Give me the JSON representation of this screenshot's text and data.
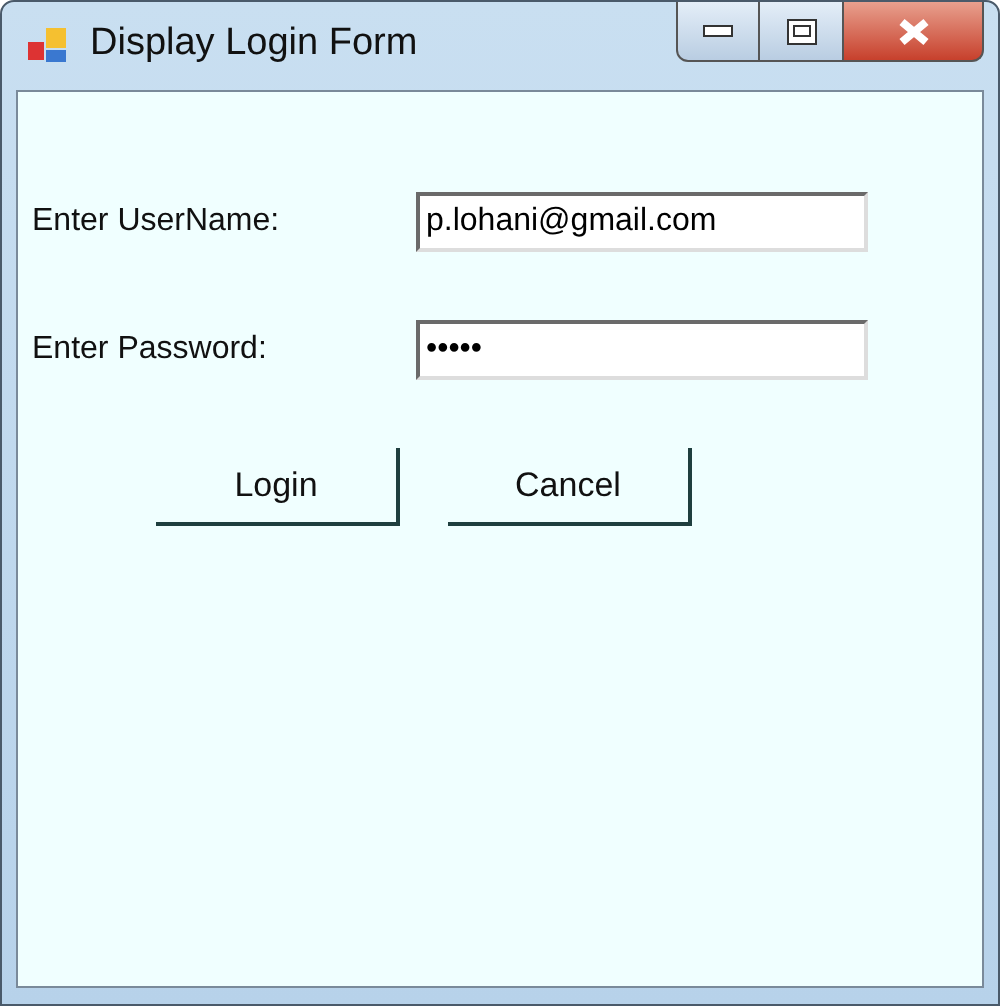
{
  "window": {
    "title": "Display Login Form"
  },
  "fields": [
    {
      "label": "Enter UserName:",
      "value": "p.lohani@gmail.com"
    },
    {
      "label": "Enter Password:",
      "value": "•••••"
    }
  ],
  "buttons": [
    "Login",
    "Cancel"
  ]
}
